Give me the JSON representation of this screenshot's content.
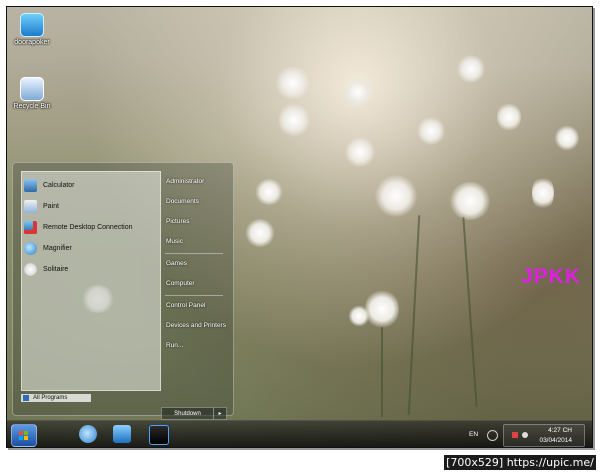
{
  "desktop": {
    "icons": [
      {
        "label": "doorapoker",
        "icon": "computer-icon"
      },
      {
        "label": "Recycle Bin",
        "icon": "recycle-bin-icon"
      }
    ],
    "watermark": "JPKK"
  },
  "start_menu": {
    "programs": [
      {
        "label": "Calculator",
        "icon": "calculator-icon"
      },
      {
        "label": "Paint",
        "icon": "paint-icon"
      },
      {
        "label": "Remote Desktop Connection",
        "icon": "remote-desktop-icon"
      },
      {
        "label": "Magnifier",
        "icon": "magnifier-icon"
      },
      {
        "label": "Solitaire",
        "icon": "solitaire-icon"
      }
    ],
    "all_programs": "All Programs",
    "places": [
      "Administrator",
      "Documents",
      "Pictures",
      "Music",
      "Games",
      "Computer",
      "Control Panel",
      "Devices and Printers",
      "Run..."
    ],
    "shutdown": "Shutdown",
    "shutdown_arrow": "▸"
  },
  "taskbar": {
    "pinned": [
      {
        "name": "internet-explorer",
        "icon": "internet-explorer-icon"
      },
      {
        "name": "file-explorer",
        "icon": "library-icon"
      },
      {
        "name": "media-player",
        "icon": "media-player-icon"
      }
    ],
    "language": "EN",
    "time": "4:27 CH",
    "date": "03/04/2014"
  },
  "footer": "[700x529] https://upic.me/",
  "colors": {
    "watermark": "#e11de6",
    "start_orb": "#1b4fa0",
    "taskbar": "#141414"
  }
}
